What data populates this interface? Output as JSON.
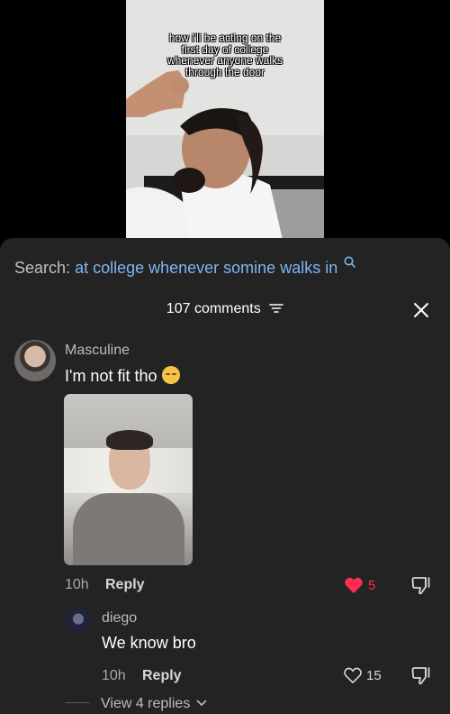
{
  "video": {
    "caption_lines": [
      "how i'll be acting on the",
      "first day of college",
      "whenever anyone walks",
      "through the door"
    ]
  },
  "search": {
    "prefix": "Search:",
    "query": "at college whenever somine walks in",
    "icon": "search-icon"
  },
  "comments_header": {
    "count_label": "107 comments",
    "filter_icon": "filter-icon",
    "close_icon": "close-icon"
  },
  "comment": {
    "author": "Masculine",
    "text": "I'm not fit tho",
    "emoji": "pensive-face-emoji",
    "time": "10h",
    "reply_label": "Reply",
    "likes": "5",
    "liked": true,
    "like_color": "#fe2c55",
    "dislike_icon": "thumbs-down-icon"
  },
  "reply": {
    "author": "diego",
    "text": "We know bro",
    "time": "10h",
    "reply_label": "Reply",
    "likes": "15",
    "liked": false,
    "dislike_icon": "thumbs-down-icon"
  },
  "view_replies": {
    "label": "View 4 replies",
    "icon": "chevron-down-icon"
  },
  "colors": {
    "sheet_background": "#232323",
    "search_query": "#7eb5f2",
    "liked_heart": "#fe2c55"
  }
}
